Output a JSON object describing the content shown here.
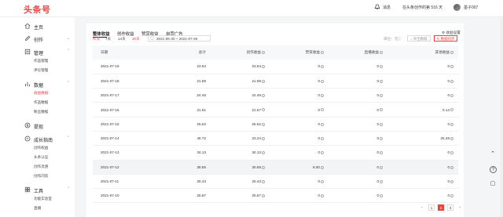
{
  "header": {
    "logo": "头条号",
    "message": "消息",
    "creation_days": "在头条创作的第 516 天",
    "username": "墨子007"
  },
  "sidebar": {
    "home": "主页",
    "create": "创作",
    "manage": "管理",
    "manage_items": [
      "作品管理",
      "评论管理"
    ],
    "data": "数据",
    "data_items": [
      "收益数据",
      "作品数据",
      "粉丝数据"
    ],
    "withdraw": "提现",
    "growth": "成长指南",
    "growth_items": [
      "创作权益",
      "头条认证",
      "创作灵感",
      "创作问答"
    ],
    "tools": "工具",
    "tools_items": [
      "功能实验室",
      "直播"
    ]
  },
  "tabs": [
    "整体收益",
    "创作收益",
    "赞赏收益",
    "自营广告"
  ],
  "periods": [
    "昨天",
    "7天",
    "14天",
    "30天"
  ],
  "date_range": "2021-06-30  ~  2021-07-29",
  "unit": "单位：元",
  "help": "收益设置",
  "buttons": {
    "export": "导出数据",
    "sync": "数据同步"
  },
  "table": {
    "headers": [
      "日期",
      "总计",
      "创作收益",
      "赞赏收益",
      "直播收益",
      "其他收益"
    ],
    "rows": [
      [
        "2021-07-19",
        "23.94",
        "23.94",
        "0",
        "0",
        "0"
      ],
      [
        "2021-07-18",
        "21.89",
        "21.89",
        "0",
        "0",
        "0"
      ],
      [
        "2021-07-17",
        "24.46",
        "24.46",
        "0",
        "0",
        "0"
      ],
      [
        "2021-07-16",
        "21.81",
        "21.67",
        "0",
        "0",
        "0.14"
      ],
      [
        "2021-07-15",
        "25.52",
        "25.52",
        "0",
        "0",
        "0"
      ],
      [
        "2021-07-14",
        "48.72",
        "23.24",
        "0",
        "0",
        "25.48"
      ],
      [
        "2021-07-13",
        "34.13",
        "34.13",
        "0",
        "0",
        "0"
      ],
      [
        "2021-07-12",
        "38.55",
        "30.55",
        "8.00",
        "0",
        "0"
      ],
      [
        "2021-07-11",
        "26.43",
        "26.43",
        "0",
        "0",
        "0"
      ],
      [
        "2021-07-10",
        "25.87",
        "25.87",
        "0",
        "0",
        "0"
      ]
    ]
  },
  "pagination": {
    "pages": [
      "1",
      "2",
      "3"
    ],
    "current": "2"
  }
}
